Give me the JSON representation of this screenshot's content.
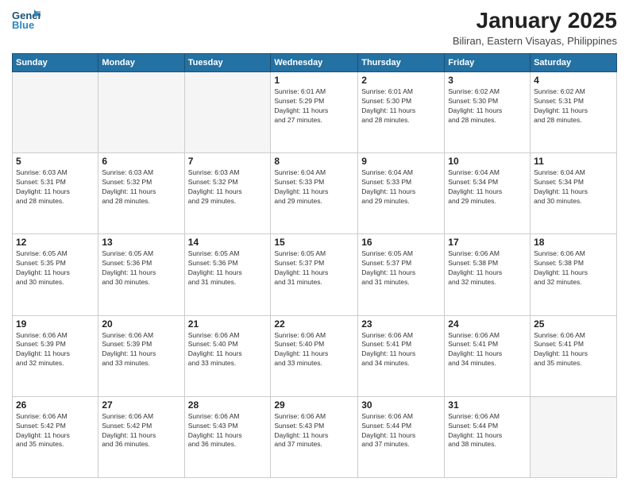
{
  "header": {
    "logo_line1": "General",
    "logo_line2": "Blue",
    "title": "January 2025",
    "subtitle": "Biliran, Eastern Visayas, Philippines"
  },
  "weekdays": [
    "Sunday",
    "Monday",
    "Tuesday",
    "Wednesday",
    "Thursday",
    "Friday",
    "Saturday"
  ],
  "weeks": [
    [
      {
        "day": "",
        "info": ""
      },
      {
        "day": "",
        "info": ""
      },
      {
        "day": "",
        "info": ""
      },
      {
        "day": "1",
        "info": "Sunrise: 6:01 AM\nSunset: 5:29 PM\nDaylight: 11 hours\nand 27 minutes."
      },
      {
        "day": "2",
        "info": "Sunrise: 6:01 AM\nSunset: 5:30 PM\nDaylight: 11 hours\nand 28 minutes."
      },
      {
        "day": "3",
        "info": "Sunrise: 6:02 AM\nSunset: 5:30 PM\nDaylight: 11 hours\nand 28 minutes."
      },
      {
        "day": "4",
        "info": "Sunrise: 6:02 AM\nSunset: 5:31 PM\nDaylight: 11 hours\nand 28 minutes."
      }
    ],
    [
      {
        "day": "5",
        "info": "Sunrise: 6:03 AM\nSunset: 5:31 PM\nDaylight: 11 hours\nand 28 minutes."
      },
      {
        "day": "6",
        "info": "Sunrise: 6:03 AM\nSunset: 5:32 PM\nDaylight: 11 hours\nand 28 minutes."
      },
      {
        "day": "7",
        "info": "Sunrise: 6:03 AM\nSunset: 5:32 PM\nDaylight: 11 hours\nand 29 minutes."
      },
      {
        "day": "8",
        "info": "Sunrise: 6:04 AM\nSunset: 5:33 PM\nDaylight: 11 hours\nand 29 minutes."
      },
      {
        "day": "9",
        "info": "Sunrise: 6:04 AM\nSunset: 5:33 PM\nDaylight: 11 hours\nand 29 minutes."
      },
      {
        "day": "10",
        "info": "Sunrise: 6:04 AM\nSunset: 5:34 PM\nDaylight: 11 hours\nand 29 minutes."
      },
      {
        "day": "11",
        "info": "Sunrise: 6:04 AM\nSunset: 5:34 PM\nDaylight: 11 hours\nand 30 minutes."
      }
    ],
    [
      {
        "day": "12",
        "info": "Sunrise: 6:05 AM\nSunset: 5:35 PM\nDaylight: 11 hours\nand 30 minutes."
      },
      {
        "day": "13",
        "info": "Sunrise: 6:05 AM\nSunset: 5:36 PM\nDaylight: 11 hours\nand 30 minutes."
      },
      {
        "day": "14",
        "info": "Sunrise: 6:05 AM\nSunset: 5:36 PM\nDaylight: 11 hours\nand 31 minutes."
      },
      {
        "day": "15",
        "info": "Sunrise: 6:05 AM\nSunset: 5:37 PM\nDaylight: 11 hours\nand 31 minutes."
      },
      {
        "day": "16",
        "info": "Sunrise: 6:05 AM\nSunset: 5:37 PM\nDaylight: 11 hours\nand 31 minutes."
      },
      {
        "day": "17",
        "info": "Sunrise: 6:06 AM\nSunset: 5:38 PM\nDaylight: 11 hours\nand 32 minutes."
      },
      {
        "day": "18",
        "info": "Sunrise: 6:06 AM\nSunset: 5:38 PM\nDaylight: 11 hours\nand 32 minutes."
      }
    ],
    [
      {
        "day": "19",
        "info": "Sunrise: 6:06 AM\nSunset: 5:39 PM\nDaylight: 11 hours\nand 32 minutes."
      },
      {
        "day": "20",
        "info": "Sunrise: 6:06 AM\nSunset: 5:39 PM\nDaylight: 11 hours\nand 33 minutes."
      },
      {
        "day": "21",
        "info": "Sunrise: 6:06 AM\nSunset: 5:40 PM\nDaylight: 11 hours\nand 33 minutes."
      },
      {
        "day": "22",
        "info": "Sunrise: 6:06 AM\nSunset: 5:40 PM\nDaylight: 11 hours\nand 33 minutes."
      },
      {
        "day": "23",
        "info": "Sunrise: 6:06 AM\nSunset: 5:41 PM\nDaylight: 11 hours\nand 34 minutes."
      },
      {
        "day": "24",
        "info": "Sunrise: 6:06 AM\nSunset: 5:41 PM\nDaylight: 11 hours\nand 34 minutes."
      },
      {
        "day": "25",
        "info": "Sunrise: 6:06 AM\nSunset: 5:41 PM\nDaylight: 11 hours\nand 35 minutes."
      }
    ],
    [
      {
        "day": "26",
        "info": "Sunrise: 6:06 AM\nSunset: 5:42 PM\nDaylight: 11 hours\nand 35 minutes."
      },
      {
        "day": "27",
        "info": "Sunrise: 6:06 AM\nSunset: 5:42 PM\nDaylight: 11 hours\nand 36 minutes."
      },
      {
        "day": "28",
        "info": "Sunrise: 6:06 AM\nSunset: 5:43 PM\nDaylight: 11 hours\nand 36 minutes."
      },
      {
        "day": "29",
        "info": "Sunrise: 6:06 AM\nSunset: 5:43 PM\nDaylight: 11 hours\nand 37 minutes."
      },
      {
        "day": "30",
        "info": "Sunrise: 6:06 AM\nSunset: 5:44 PM\nDaylight: 11 hours\nand 37 minutes."
      },
      {
        "day": "31",
        "info": "Sunrise: 6:06 AM\nSunset: 5:44 PM\nDaylight: 11 hours\nand 38 minutes."
      },
      {
        "day": "",
        "info": ""
      }
    ]
  ]
}
